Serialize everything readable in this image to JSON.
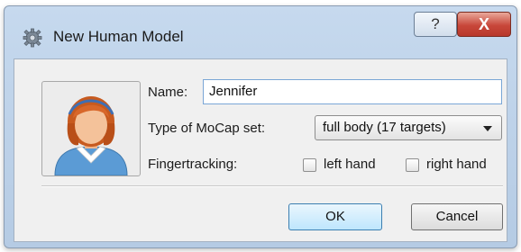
{
  "window": {
    "title": "New Human Model",
    "title_icon": "gear-icon",
    "help_label": "?",
    "close_label": "X"
  },
  "form": {
    "avatar_icon": "female-avatar-icon",
    "name_label": "Name:",
    "name_value": "Jennifer",
    "mocap_label": "Type of MoCap set:",
    "mocap_selected": "full body (17 targets)",
    "fingertracking_label": "Fingertracking:",
    "left_hand_label": "left hand",
    "right_hand_label": "right hand"
  },
  "buttons": {
    "ok_label": "OK",
    "cancel_label": "Cancel"
  }
}
